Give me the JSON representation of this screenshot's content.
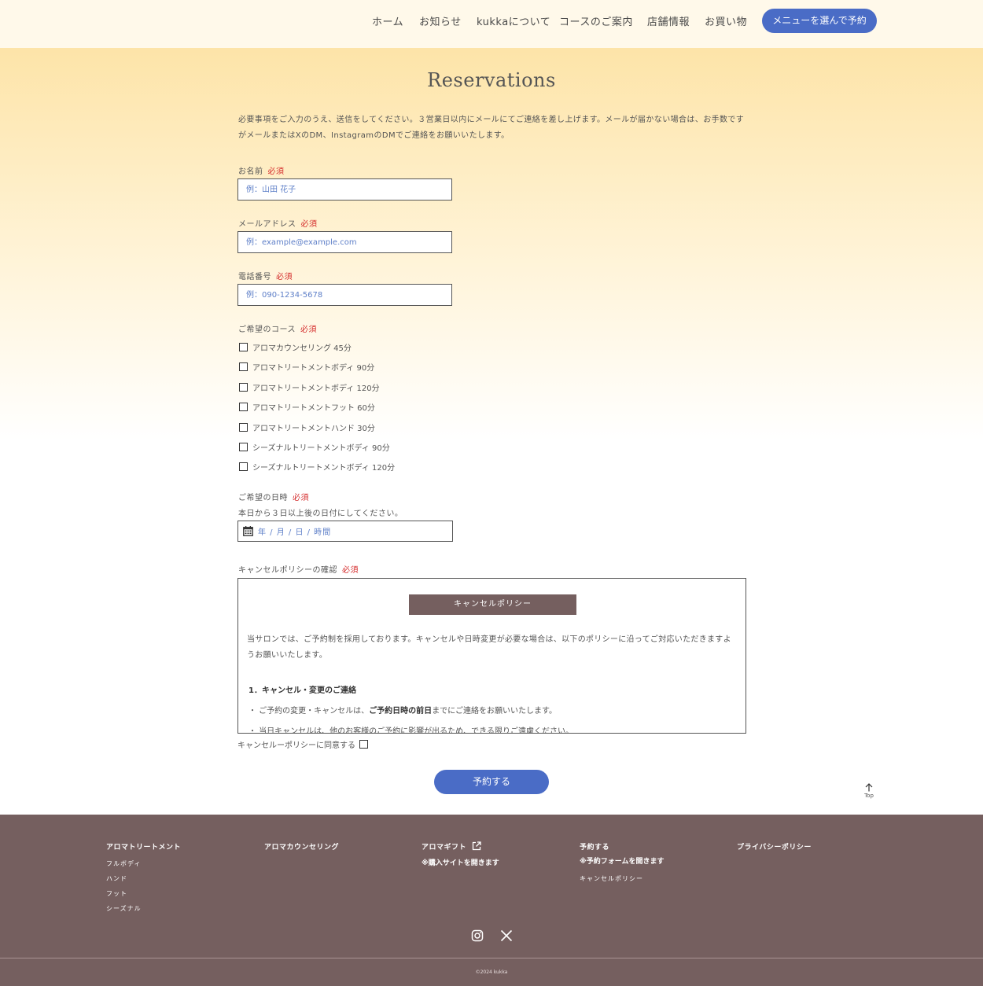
{
  "nav": {
    "items": [
      "ホーム",
      "お知らせ",
      "kukkaについて",
      "コースのご案内",
      "店舗情報",
      "お買い物"
    ],
    "cta": "メニューを選んで予約"
  },
  "page": {
    "title": "Reservations",
    "intro": "必要事項をご入力のうえ、送信をしてください。３営業日以内にメールにてご連絡を差し上げます。メールが届かない場合は、お手数ですがメールまたはXのDM、InstagramのDMでご連絡をお願いいたします。"
  },
  "form": {
    "required": "必須",
    "name": {
      "label": "お名前",
      "placeholder": "例：山田 花子"
    },
    "email": {
      "label": "メールアドレス",
      "placeholder": "例：example@example.com"
    },
    "phone": {
      "label": "電話番号",
      "placeholder": "例：090-1234-5678"
    },
    "course": {
      "label": "ご希望のコース",
      "options": [
        "アロマカウンセリング 45分",
        "アロマトリートメントボディ 90分",
        "アロマトリートメントボディ 120分",
        "アロマトリートメントフット 60分",
        "アロマトリートメントハンド 30分",
        "シーズナルトリートメントボディ 90分",
        "シーズナルトリートメントボディ 120分"
      ]
    },
    "datetime": {
      "label": "ご希望の日時",
      "note": "本日から３日以上後の日付にしてください。",
      "placeholder": "年 / 月 / 日 / 時間"
    },
    "policy": {
      "label": "キャンセルポリシーの確認",
      "heading": "キャンセルポリシー",
      "paragraph": "当サロンでは、ご予約制を採用しております。キャンセルや日時変更が必要な場合は、以下のポリシーに沿ってご対応いただきますようお願いいたします。",
      "section1": "1．キャンセル・変更のご連絡",
      "item1_pre": "・ ご予約の変更・キャンセルは、",
      "item1_bold": "ご予約日時の前日",
      "item1_post": "までにご連絡をお願いいたします。",
      "item2": "・ 当日キャンセルは、他のお客様のご予約に影響が出るため、できる限りご遠慮ください。"
    },
    "agree": "キャンセルーポリシーに同意する",
    "submit": "予約する"
  },
  "top_link": "Top",
  "footer": {
    "col1": {
      "head": "アロマトリートメント",
      "links": [
        "フルボディ",
        "ハンド",
        "フット",
        "シーズナル"
      ]
    },
    "col2": {
      "head": "アロマカウンセリング"
    },
    "col3": {
      "head": "アロマギフト",
      "sub": "※購入サイトを開きます"
    },
    "col4": {
      "head": "予約する",
      "sub": "※予約フォームを開きます",
      "link": "キャンセルポリシー"
    },
    "col5": {
      "head": "プライバシーポリシー"
    },
    "copyright": "©2024 kukka"
  },
  "colors": {
    "accent": "#4a6cc6",
    "footer": "#755f5f",
    "required": "#d42a2a"
  }
}
